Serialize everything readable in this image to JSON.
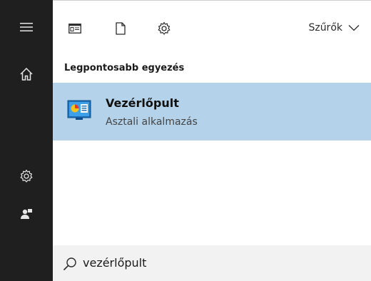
{
  "header": {
    "filters_label": "Szűrők"
  },
  "results": {
    "section_title": "Legpontosabb egyezés",
    "best_match": {
      "title": "Vezérlőpult",
      "subtitle": "Asztali alkalmazás"
    }
  },
  "search": {
    "query": "vezérlőpult"
  },
  "icons": {
    "rail": [
      "menu-icon",
      "home-icon",
      "settings-icon",
      "user-icon"
    ],
    "toolbar": [
      "apps-icon",
      "documents-icon",
      "web-settings-icon"
    ],
    "result": "control-panel-icon",
    "search": "search-icon"
  },
  "colors": {
    "rail_bg": "#1f1f1f",
    "selected_bg": "#b4d3ea",
    "search_bg": "#f2f2f2"
  }
}
